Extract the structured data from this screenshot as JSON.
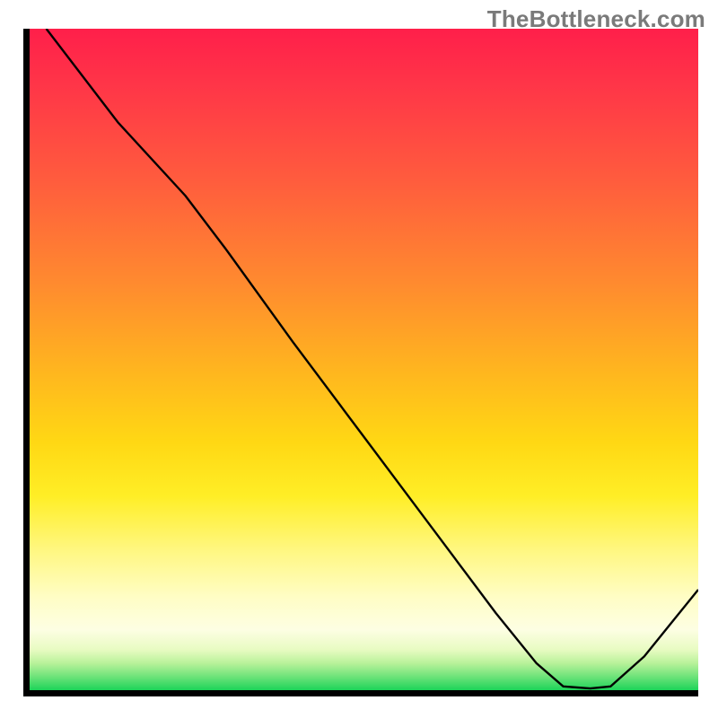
{
  "watermark": "TheBottleneck.com",
  "chart_data": {
    "type": "line",
    "title": "",
    "xlabel": "",
    "ylabel": "",
    "xlim": [
      0,
      100
    ],
    "ylim": [
      0,
      100
    ],
    "background_gradient": {
      "top_color": "#ff1f4a",
      "mid_color": "#ffd814",
      "bottom_color": "#05c94e"
    },
    "curve": {
      "description": "bottleneck curve — descends from upper-left, flattens at the minimum around x≈80–87, then rises toward the right edge",
      "points": [
        {
          "x": 3.4,
          "y": 100
        },
        {
          "x": 14,
          "y": 86
        },
        {
          "x": 24,
          "y": 75
        },
        {
          "x": 30,
          "y": 67
        },
        {
          "x": 40,
          "y": 53
        },
        {
          "x": 50,
          "y": 39.5
        },
        {
          "x": 60,
          "y": 26
        },
        {
          "x": 70,
          "y": 12.5
        },
        {
          "x": 76,
          "y": 5
        },
        {
          "x": 80,
          "y": 1.5
        },
        {
          "x": 84,
          "y": 1.2
        },
        {
          "x": 87,
          "y": 1.5
        },
        {
          "x": 92,
          "y": 6
        },
        {
          "x": 96,
          "y": 11
        },
        {
          "x": 100,
          "y": 16
        }
      ]
    }
  }
}
